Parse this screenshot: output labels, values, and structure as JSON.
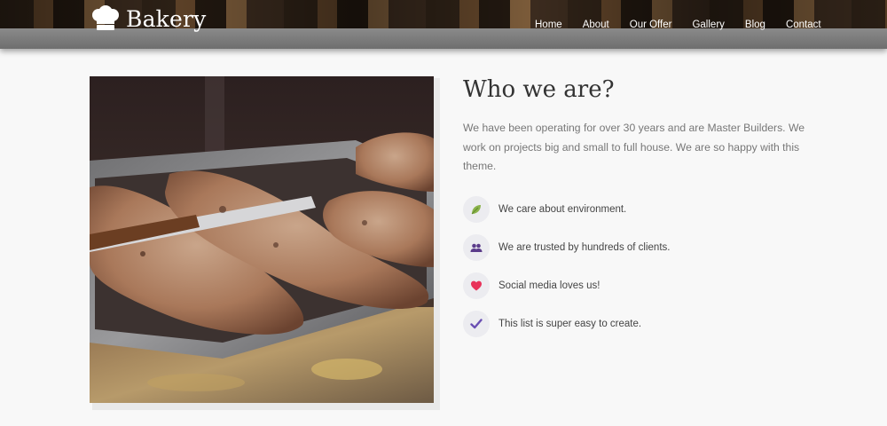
{
  "brand": {
    "name": "Bakery",
    "logo_icon": "chef-hat-icon"
  },
  "nav": {
    "items": [
      "Home",
      "About",
      "Our Offer",
      "Gallery",
      "Blog",
      "Contact"
    ]
  },
  "about": {
    "title": "Who we are?",
    "description": "We have been operating for over 30 years and are Master Builders. We work on projects big and small to full house. We are so happy with this theme.",
    "features": [
      {
        "icon": "leaf-icon",
        "text": "We care about environment."
      },
      {
        "icon": "users-icon",
        "text": "We are trusted by hundreds of clients."
      },
      {
        "icon": "heart-icon",
        "text": "Social media loves us!"
      },
      {
        "icon": "checkmark-icon",
        "text": "This list is super easy to create."
      }
    ]
  },
  "colors": {
    "accent": "#6a4fb3",
    "heart": "#e8335a",
    "leaf": "#8ab24a"
  }
}
